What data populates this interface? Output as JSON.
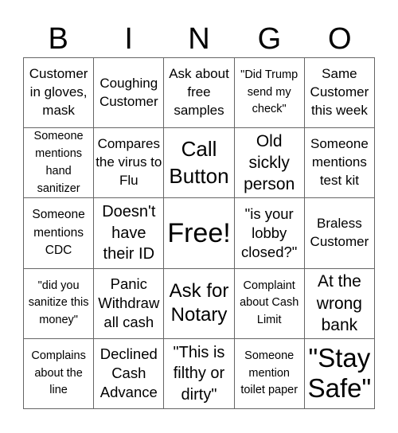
{
  "header": [
    "B",
    "I",
    "N",
    "G",
    "O"
  ],
  "cells": [
    [
      "Customer in gloves, mask",
      "Coughing Customer",
      "Ask about free samples",
      "\"Did Trump send my check\"",
      "Same Customer this week"
    ],
    [
      "Someone mentions hand sanitizer",
      "Compares the virus to Flu",
      "Call Button",
      "Old sickly person",
      "Someone mentions test kit"
    ],
    [
      "Someone mentions CDC",
      "Doesn't have their ID",
      "Free!",
      "\"is your lobby closed?\"",
      "Braless Customer"
    ],
    [
      "\"did you sanitize this money\"",
      "Panic Withdraw all cash",
      "Ask for Notary",
      "Complaint about Cash Limit",
      "At the wrong bank"
    ],
    [
      "Complains about the line",
      "Declined Cash Advance",
      "\"This is filthy or dirty\"",
      "Someone mention toilet paper",
      "\"Stay Safe\""
    ]
  ]
}
